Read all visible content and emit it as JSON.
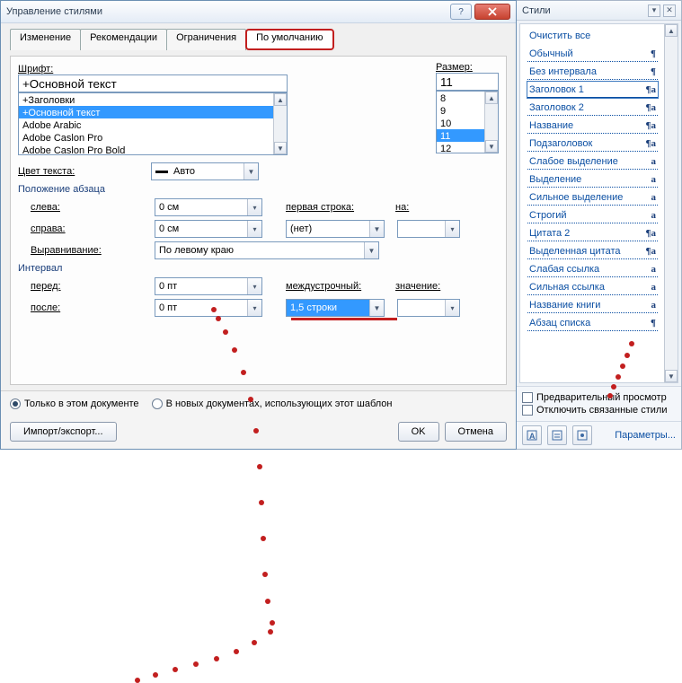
{
  "dialog": {
    "title": "Управление стилями",
    "tabs": [
      "Изменение",
      "Рекомендации",
      "Ограничения",
      "По умолчанию"
    ],
    "active_tab": 3,
    "font": {
      "label": "Шрифт:",
      "value": "+Основной текст",
      "items": [
        "+Заголовки",
        "+Основной текст",
        "Adobe Arabic",
        "Adobe Caslon Pro",
        "Adobe Caslon Pro Bold"
      ],
      "selected_index": 1
    },
    "size": {
      "label": "Размер:",
      "value": "11",
      "items": [
        "8",
        "9",
        "10",
        "11",
        "12"
      ],
      "selected_index": 3
    },
    "textcolor": {
      "label": "Цвет текста:",
      "value": "Авто"
    },
    "para_pos": {
      "legend": "Положение абзаца",
      "left_label": "слева:",
      "left_value": "0 см",
      "right_label": "справа:",
      "right_value": "0 см",
      "firstline_label": "первая строка:",
      "firstline_value": "(нет)",
      "by_label": "на:",
      "by_value": "",
      "align_label": "Выравнивание:",
      "align_value": "По левому краю"
    },
    "interval": {
      "legend": "Интервал",
      "before_label": "перед:",
      "before_value": "0 пт",
      "after_label": "после:",
      "after_value": "0 пт",
      "line_label": "междустрочный:",
      "line_value": "1,5 строки",
      "at_label": "значение:",
      "at_value": ""
    },
    "footer": {
      "scope_this": "Только в этом документе",
      "scope_tpl": "В новых документах, использующих этот шаблон",
      "import": "Импорт/экспорт...",
      "ok": "OK",
      "cancel": "Отмена"
    }
  },
  "panel": {
    "title": "Стили",
    "items": [
      {
        "name": "Очистить все",
        "glyph": ""
      },
      {
        "name": "Обычный",
        "glyph": "¶"
      },
      {
        "name": "Без интервала",
        "glyph": "¶"
      },
      {
        "name": "Заголовок 1",
        "glyph": "¶a",
        "sel": true
      },
      {
        "name": "Заголовок 2",
        "glyph": "¶a"
      },
      {
        "name": "Название",
        "glyph": "¶a"
      },
      {
        "name": "Подзаголовок",
        "glyph": "¶a"
      },
      {
        "name": "Слабое выделение",
        "glyph": "a"
      },
      {
        "name": "Выделение",
        "glyph": "a"
      },
      {
        "name": "Сильное выделение",
        "glyph": "a"
      },
      {
        "name": "Строгий",
        "glyph": "a"
      },
      {
        "name": "Цитата 2",
        "glyph": "¶a"
      },
      {
        "name": "Выделенная цитата",
        "glyph": "¶a"
      },
      {
        "name": "Слабая ссылка",
        "glyph": "a"
      },
      {
        "name": "Сильная ссылка",
        "glyph": "a"
      },
      {
        "name": "Название книги",
        "glyph": "a"
      },
      {
        "name": "Абзац списка",
        "glyph": "¶"
      }
    ],
    "preview": "Предварительный просмотр",
    "disable_linked": "Отключить связанные стили",
    "options": "Параметры..."
  }
}
